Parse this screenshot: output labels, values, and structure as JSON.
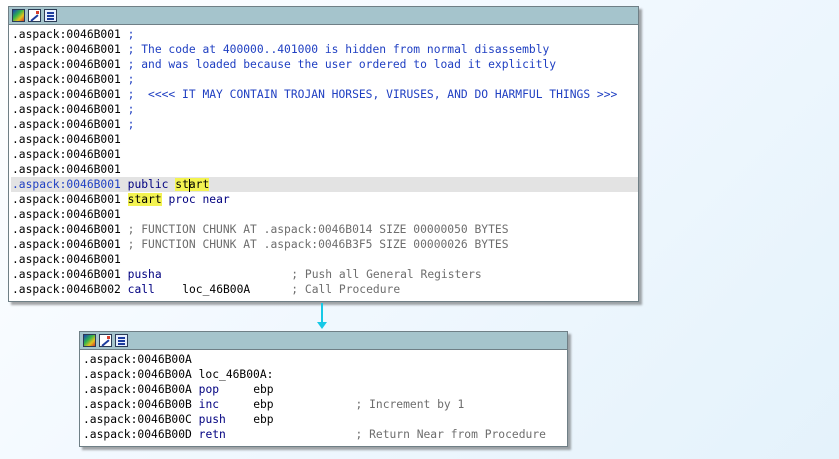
{
  "nodes": [
    {
      "lines": [
        {
          "addr": ".aspack:0046B001",
          "text": " ;",
          "kind": "cmt"
        },
        {
          "addr": ".aspack:0046B001",
          "text": " ; The code at 400000..401000 is hidden from normal disassembly",
          "kind": "cmt"
        },
        {
          "addr": ".aspack:0046B001",
          "text": " ; and was loaded because the user ordered to load it explicitly",
          "kind": "cmt"
        },
        {
          "addr": ".aspack:0046B001",
          "text": " ;",
          "kind": "cmt"
        },
        {
          "addr": ".aspack:0046B001",
          "text": " ;  <<<< IT MAY CONTAIN TROJAN HORSES, VIRUSES, AND DO HARMFUL THINGS >>>",
          "kind": "cmt"
        },
        {
          "addr": ".aspack:0046B001",
          "text": " ;",
          "kind": "cmt"
        },
        {
          "addr": ".aspack:0046B001",
          "text": " ;",
          "kind": "cmt"
        },
        {
          "addr": ".aspack:0046B001",
          "text": "",
          "kind": "plain"
        },
        {
          "addr": ".aspack:0046B001",
          "text": "",
          "kind": "plain"
        },
        {
          "addr": ".aspack:0046B001",
          "text": "",
          "kind": "plain"
        },
        {
          "addr": ".aspack:0046B001",
          "text": "",
          "kind": "public"
        },
        {
          "addr": ".aspack:0046B001",
          "text": "",
          "kind": "proc"
        },
        {
          "addr": ".aspack:0046B001",
          "text": "",
          "kind": "plain"
        },
        {
          "addr": ".aspack:0046B001",
          "text": " ; FUNCTION CHUNK AT .aspack:0046B014 SIZE 00000050 BYTES",
          "kind": "gcmt"
        },
        {
          "addr": ".aspack:0046B001",
          "text": " ; FUNCTION CHUNK AT .aspack:0046B3F5 SIZE 00000026 BYTES",
          "kind": "gcmt"
        },
        {
          "addr": ".aspack:0046B001",
          "text": "",
          "kind": "plain"
        },
        {
          "addr": ".aspack:0046B001",
          "text": "",
          "kind": "insn",
          "mnem": "pusha",
          "ops": "",
          "comment": "; Push all General Registers"
        },
        {
          "addr": ".aspack:0046B002",
          "text": "",
          "kind": "insn",
          "mnem": "call",
          "ops": "loc_46B00A",
          "comment": "; Call Procedure"
        }
      ]
    },
    {
      "lines": [
        {
          "addr": ".aspack:0046B00A",
          "text": "",
          "kind": "plain"
        },
        {
          "addr": ".aspack:0046B00A",
          "text": " loc_46B00A:",
          "kind": "label"
        },
        {
          "addr": ".aspack:0046B00A",
          "text": "",
          "kind": "insn",
          "mnem": "pop",
          "ops": "ebp",
          "comment": ""
        },
        {
          "addr": ".aspack:0046B00B",
          "text": "",
          "kind": "insn",
          "mnem": "inc",
          "ops": "ebp",
          "comment": "; Increment by 1"
        },
        {
          "addr": ".aspack:0046B00C",
          "text": "",
          "kind": "insn",
          "mnem": "push",
          "ops": "ebp",
          "comment": ""
        },
        {
          "addr": ".aspack:0046B00D",
          "text": "",
          "kind": "insn",
          "mnem": "retn",
          "ops": "",
          "comment": "; Return Near from Procedure"
        }
      ]
    }
  ],
  "public_kw": "public",
  "start_a": "st",
  "start_b": "art",
  "start_name": "start",
  "proc_text": "proc near",
  "icons": [
    "color-icon",
    "edit-icon",
    "graph-icon"
  ],
  "colors": {
    "title_bar": "#a5c4cc",
    "comment": "#1f3fc2",
    "highlight": "#f3f351",
    "edge": "#17c9e6"
  }
}
